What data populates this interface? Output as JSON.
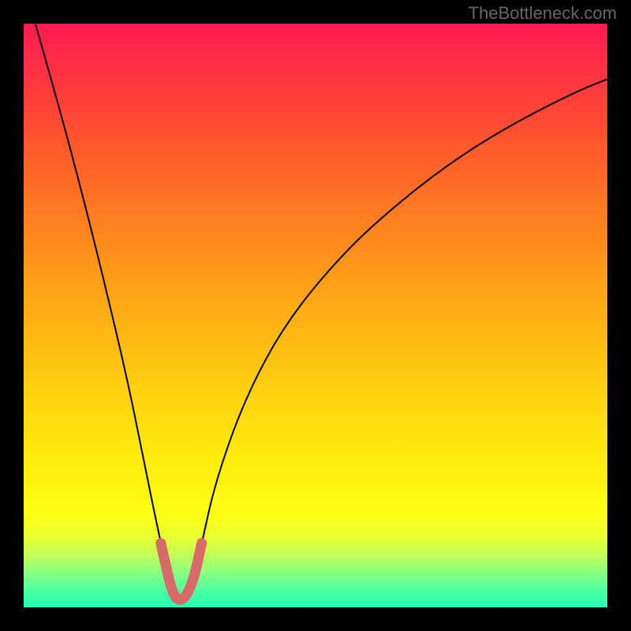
{
  "watermark": "TheBottleneck.com",
  "chart_data": {
    "type": "line",
    "title": "",
    "xlabel": "",
    "ylabel": "",
    "description": "Bottleneck percentage curve over a red-yellow-green gradient background. Y axis (top=100 bad/red, bottom=0 good/green). Curve descends steeply from top-left to a minimum near x≈0.27 (valley touching the green band), then rises with diminishing slope toward top-right.",
    "xlim": [
      0,
      1
    ],
    "ylim": [
      0,
      100
    ],
    "series": [
      {
        "name": "bottleneck-curve",
        "color": "#000000",
        "x": [
          0.02,
          0.06,
          0.1,
          0.14,
          0.18,
          0.21,
          0.235,
          0.248,
          0.26,
          0.27,
          0.28,
          0.292,
          0.305,
          0.33,
          0.38,
          0.45,
          0.55,
          0.65,
          0.75,
          0.85,
          0.95,
          1.0
        ],
        "values": [
          100,
          86,
          71,
          55,
          38,
          23,
          11,
          5,
          1.5,
          1,
          1.5,
          5,
          11,
          22,
          36,
          49,
          61,
          70,
          77.5,
          83.5,
          88.5,
          90.5
        ]
      },
      {
        "name": "valley-highlight",
        "color": "#d86a6a",
        "x": [
          0.235,
          0.248,
          0.258,
          0.268,
          0.278,
          0.292,
          0.305
        ],
        "values": [
          11,
          5,
          1.8,
          1.2,
          1.8,
          5,
          11
        ]
      }
    ],
    "gradient_stops": [
      {
        "pct": 0,
        "color": "#ff1952"
      },
      {
        "pct": 22,
        "color": "#ff5c2c"
      },
      {
        "pct": 52,
        "color": "#ffb414"
      },
      {
        "pct": 80,
        "color": "#fff60e"
      },
      {
        "pct": 100,
        "color": "#22ffb8"
      }
    ]
  }
}
